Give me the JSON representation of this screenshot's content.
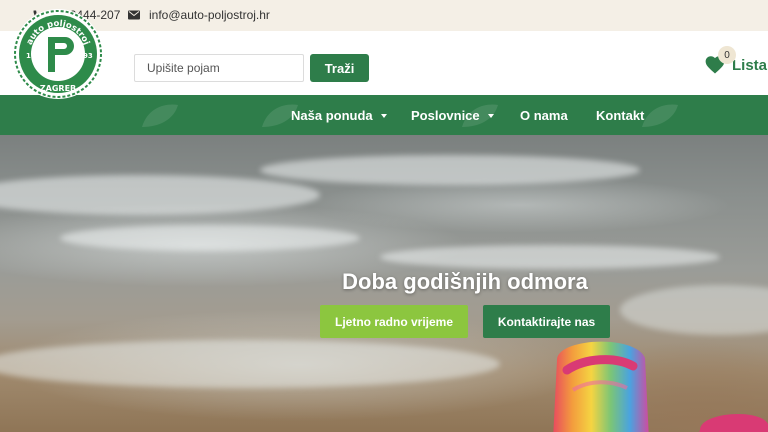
{
  "topbar": {
    "phone": "01/2444-207",
    "email": "info@auto-poljostroj.hr"
  },
  "logo": {
    "arc_text": "auto poljostroj",
    "year_left": "19",
    "year_right": "93",
    "city": "ZAGREB"
  },
  "search": {
    "placeholder": "Upišite pojam",
    "value": "",
    "button_label": "Traži"
  },
  "wishlist": {
    "count": "0",
    "label": "Lista"
  },
  "nav": {
    "items": [
      {
        "label": "Naša ponuda",
        "has_dropdown": true
      },
      {
        "label": "Poslovnice",
        "has_dropdown": true
      },
      {
        "label": "O nama",
        "has_dropdown": false
      },
      {
        "label": "Kontakt",
        "has_dropdown": false
      }
    ]
  },
  "hero": {
    "title": "Doba godišnjih odmora",
    "primary_button": "Ljetno radno vrijeme",
    "secondary_button": "Kontaktirajte nas"
  },
  "colors": {
    "brand_green": "#2e7d4a",
    "accent_lime": "#8cc63f",
    "topbar_bg": "#f4efe6"
  }
}
